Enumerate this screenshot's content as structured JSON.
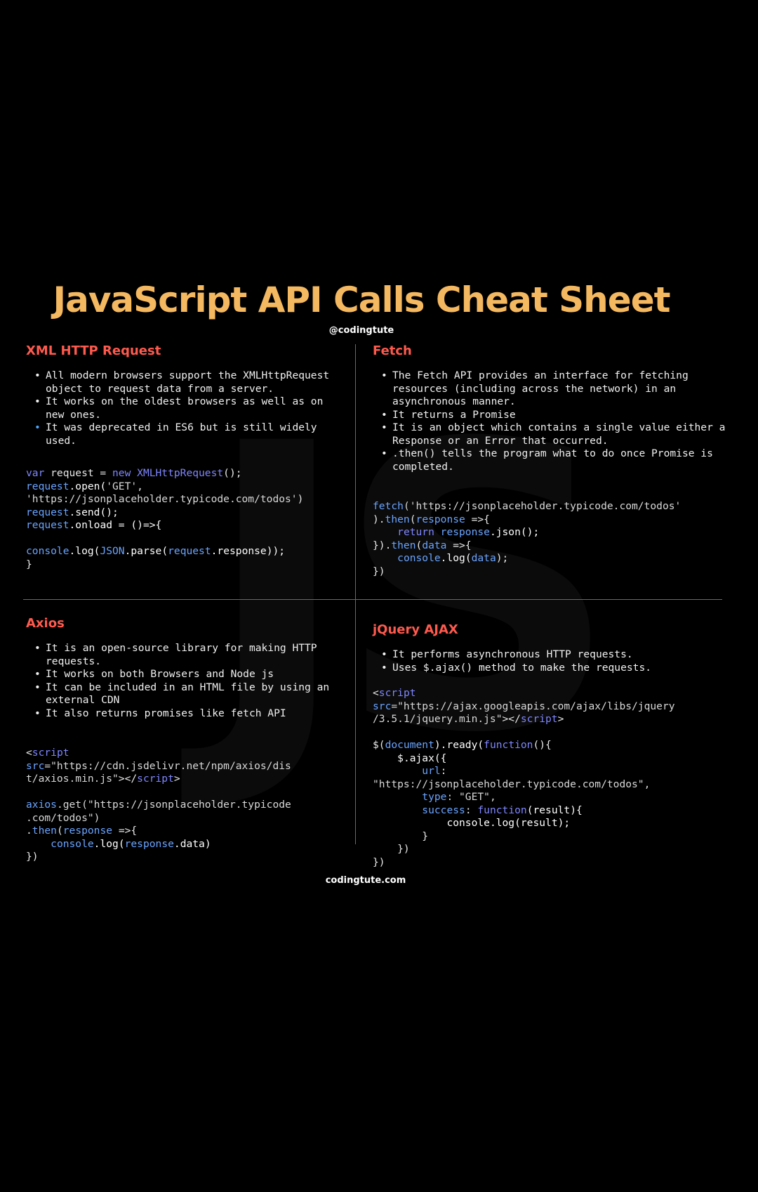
{
  "title": "JavaScript API Calls Cheat Sheet",
  "handle": "@codingtute",
  "footer": "codingtute.com",
  "watermark": "JS",
  "colors": {
    "title": "#f4b860",
    "heading": "#ff5a4e",
    "keyword": "#7f86ff",
    "identifier": "#6aa4ff",
    "background": "#000000"
  },
  "sections": {
    "xhr": {
      "heading": "XML HTTP Request",
      "bullets": [
        "All modern browsers support the XMLHttpRequest object to request data from a server.",
        "It works on the oldest browsers as well as on new ones.",
        "It was deprecated in ES6 but is still widely used."
      ],
      "code": {
        "l1a": "var",
        "l1b": " request = ",
        "l1c": "new",
        "l1d": " XMLHttpRequest",
        "l1e": "();",
        "l2a": "request",
        "l2b": ".open(",
        "l2c": "'GET'",
        "l2d": ",",
        "l3a": "'https://jsonplaceholder.typicode.com/todos'",
        "l3b": ")",
        "l4a": "request",
        "l4b": ".send();",
        "l5a": "request",
        "l5b": ".onload = ()=>{",
        "l6a": "console",
        "l6b": ".log(",
        "l6c": "JSON",
        "l6d": ".parse(",
        "l6e": "request",
        "l6f": ".response));",
        "l7": "}"
      }
    },
    "fetch": {
      "heading": "Fetch",
      "bullets": [
        "The Fetch API provides an interface for fetching resources (including across the network) in an asynchronous manner.",
        "It returns a Promise",
        "It is an object which contains a single value either a Response or an Error that occurred.",
        ".then() tells the program what to do once Promise is completed."
      ],
      "code": {
        "l1a": "fetch",
        "l1b": "('https://jsonplaceholder.typicode.com/todos'",
        "l2a": ").",
        "l2b": "then",
        "l2c": "(",
        "l2d": "response",
        "l2e": " =>{",
        "l3a": "    ",
        "l3b": "return",
        "l3c": " response",
        "l3d": ".json();",
        "l4a": "}).",
        "l4b": "then",
        "l4c": "(",
        "l4d": "data",
        "l4e": " =>{",
        "l5a": "    ",
        "l5b": "console",
        "l5c": ".log(",
        "l5d": "data",
        "l5e": ");",
        "l6": "})"
      }
    },
    "axios": {
      "heading": "Axios",
      "bullets": [
        "It is an open-source library for making HTTP requests.",
        "It works on both Browsers and Node js",
        "It can be included in an HTML file by using an external CDN",
        "It also returns promises like fetch API"
      ],
      "code": {
        "s1a": "<",
        "s1b": "script",
        "s2a": "src",
        "s2b": "=\"https://cdn.jsdelivr.net/npm/axios/dis",
        "s3a": "t/axios.min.js\"",
        "s3b": "></",
        "s3c": "script",
        "s3d": ">",
        "l1a": "axios",
        "l1b": ".get(\"https://jsonplaceholder.typicode",
        "l2": ".com/todos\")",
        "l3a": ".",
        "l3b": "then",
        "l3c": "(",
        "l3d": "response",
        "l3e": " =>{",
        "l4a": "    ",
        "l4b": "console",
        "l4c": ".log(",
        "l4d": "response",
        "l4e": ".data)",
        "l5": "})"
      }
    },
    "jquery": {
      "heading": "jQuery AJAX",
      "bullets": [
        "It performs asynchronous HTTP requests.",
        "Uses $.ajax() method to make the requests."
      ],
      "code": {
        "s1a": "<",
        "s1b": "script",
        "s2a": "src",
        "s2b": "=\"https://ajax.googleapis.com/ajax/libs/jquery",
        "s3a": "/3.5.1/jquery.min.js\"",
        "s3b": "></",
        "s3c": "script",
        "s3d": ">",
        "l1a": "$(",
        "l1b": "document",
        "l1c": ").ready(",
        "l1d": "function",
        "l1e": "(){",
        "l2a": "    ",
        "l2b": "$",
        "l2c": ".ajax({",
        "l3a": "        ",
        "l3b": "url",
        "l3c": ":",
        "l4": "\"https://jsonplaceholder.typicode.com/todos\",",
        "l5a": "        ",
        "l5b": "type",
        "l5c": ": \"GET\",",
        "l6a": "        ",
        "l6b": "success",
        "l6c": ": ",
        "l6d": "function",
        "l6e": "(result){",
        "l7a": "            ",
        "l7b": "console",
        "l7c": ".log(result);",
        "l8": "        }",
        "l9": "    })",
        "l10": "})"
      }
    }
  }
}
